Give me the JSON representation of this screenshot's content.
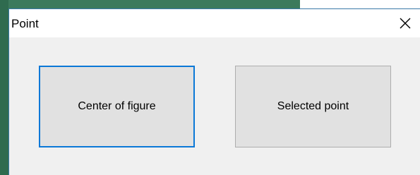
{
  "window": {
    "title": "Point",
    "close_icon": "close-icon"
  },
  "buttons": {
    "center_of_figure": "Center of figure",
    "selected_point": "Selected point"
  },
  "colors": {
    "focus_border": "#0a78d7",
    "button_face": "#e1e1e1",
    "dialog_background": "#f0f0f0",
    "backdrop_green": "#3c7a5c"
  }
}
